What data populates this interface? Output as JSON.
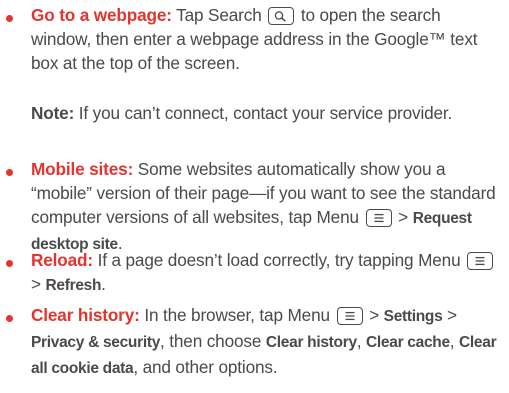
{
  "bullet_color": "#e3342f",
  "text_color": "#4a4a4a",
  "items": [
    {
      "term": "Go to a webpage:",
      "text_1": " Tap Search ",
      "icon": "search-icon",
      "text_2": " to open the search window, then enter a webpage address in the Google™ text box at the top of the screen."
    },
    {
      "term": "Mobile sites:",
      "text_1": " Some websites automatically show you a “mobile” version of their page—if you want to see the standard computer versions of all websites, tap Menu ",
      "icon": "menu-icon",
      "text_2": " > ",
      "label_1": "Request desktop site",
      "text_3": "."
    },
    {
      "term": "Reload:",
      "text_1": " If a page doesn’t load correctly, try tapping Menu ",
      "icon": "menu-icon",
      "text_2": " > ",
      "label_1": "Refresh",
      "text_3": "."
    },
    {
      "term": "Clear history:",
      "text_1": " In the browser, tap Menu ",
      "icon": "menu-icon",
      "text_2": " > ",
      "label_1": "Settings",
      "text_3": " > ",
      "label_2": "Privacy & security",
      "text_4": ", then choose ",
      "label_3": "Clear history",
      "text_5": ", ",
      "label_4": "Clear cache",
      "text_6": ", ",
      "label_5": "Clear all cookie data",
      "text_7": ", and other options."
    }
  ],
  "note": {
    "label": "Note:",
    "text": " If you can’t connect, contact your service provider."
  }
}
